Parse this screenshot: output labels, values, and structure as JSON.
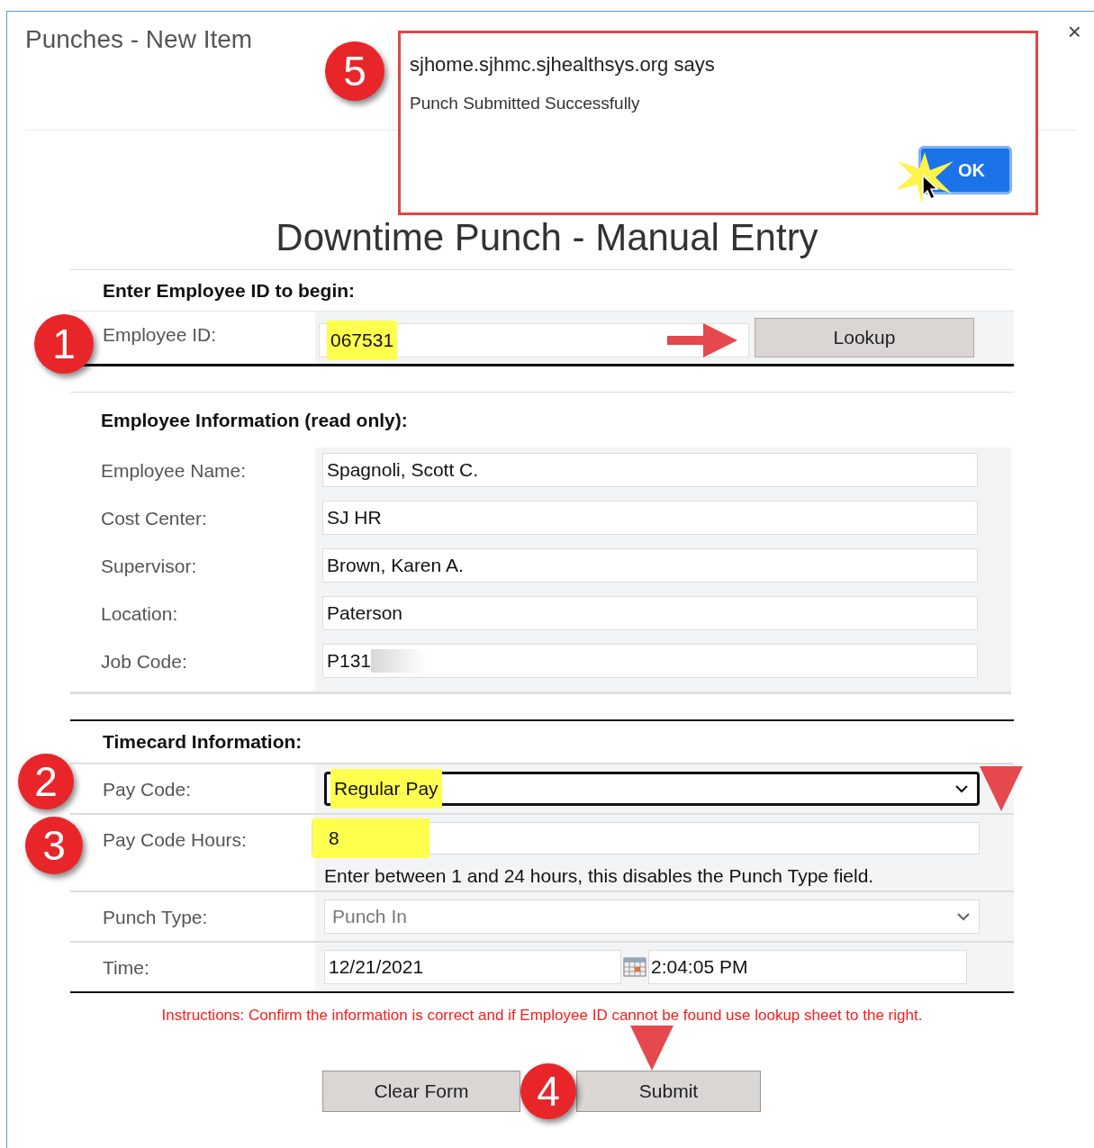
{
  "dialog": {
    "title": "Punches - New Item",
    "close": "×"
  },
  "alert": {
    "origin": "sjhome.sjhmc.sjhealthsys.org says",
    "message": "Punch Submitted Successfully",
    "button": "OK",
    "callout": "5"
  },
  "heading": "Downtime Punch - Manual Entry",
  "id_section": {
    "title": "Enter Employee ID to begin:",
    "label": "Employee ID:",
    "value": "067531",
    "highlighted": true,
    "button": "Lookup",
    "callout": "1"
  },
  "info_section": {
    "title": "Employee Information (read only):",
    "rows": [
      {
        "label": "Employee Name:",
        "value": "Spagnoli, Scott C."
      },
      {
        "label": "Cost Center:",
        "value": "SJ HR"
      },
      {
        "label": "Supervisor:",
        "value": "Brown, Karen A."
      },
      {
        "label": "Location:",
        "value": "Paterson"
      },
      {
        "label": "Job Code:",
        "value": "P131",
        "blurred": true
      }
    ]
  },
  "timecard_section": {
    "title": "Timecard Information:",
    "rows": [
      {
        "kind": "select",
        "label": "Pay Code:",
        "value": "Regular Pay",
        "highlighted": true,
        "focused": true,
        "disabled": false,
        "callout": "2"
      },
      {
        "kind": "text",
        "label": "Pay Code Hours:",
        "value": "8",
        "highlighted": true,
        "hint": "Enter between 1 and 24 hours, this disables the Punch Type field.",
        "callout": "3"
      },
      {
        "kind": "select",
        "label": "Punch Type:",
        "value": "Punch In",
        "highlighted": false,
        "focused": false,
        "disabled": true
      },
      {
        "kind": "datetime",
        "label": "Time:",
        "date": "12/21/2021",
        "time": "2:04:05 PM"
      }
    ]
  },
  "instructions": "Instructions: Confirm the information is correct and if Employee ID cannot be found use lookup sheet to the right.",
  "buttons": [
    "Clear Form",
    "Submit"
  ],
  "submit_callout": "4"
}
